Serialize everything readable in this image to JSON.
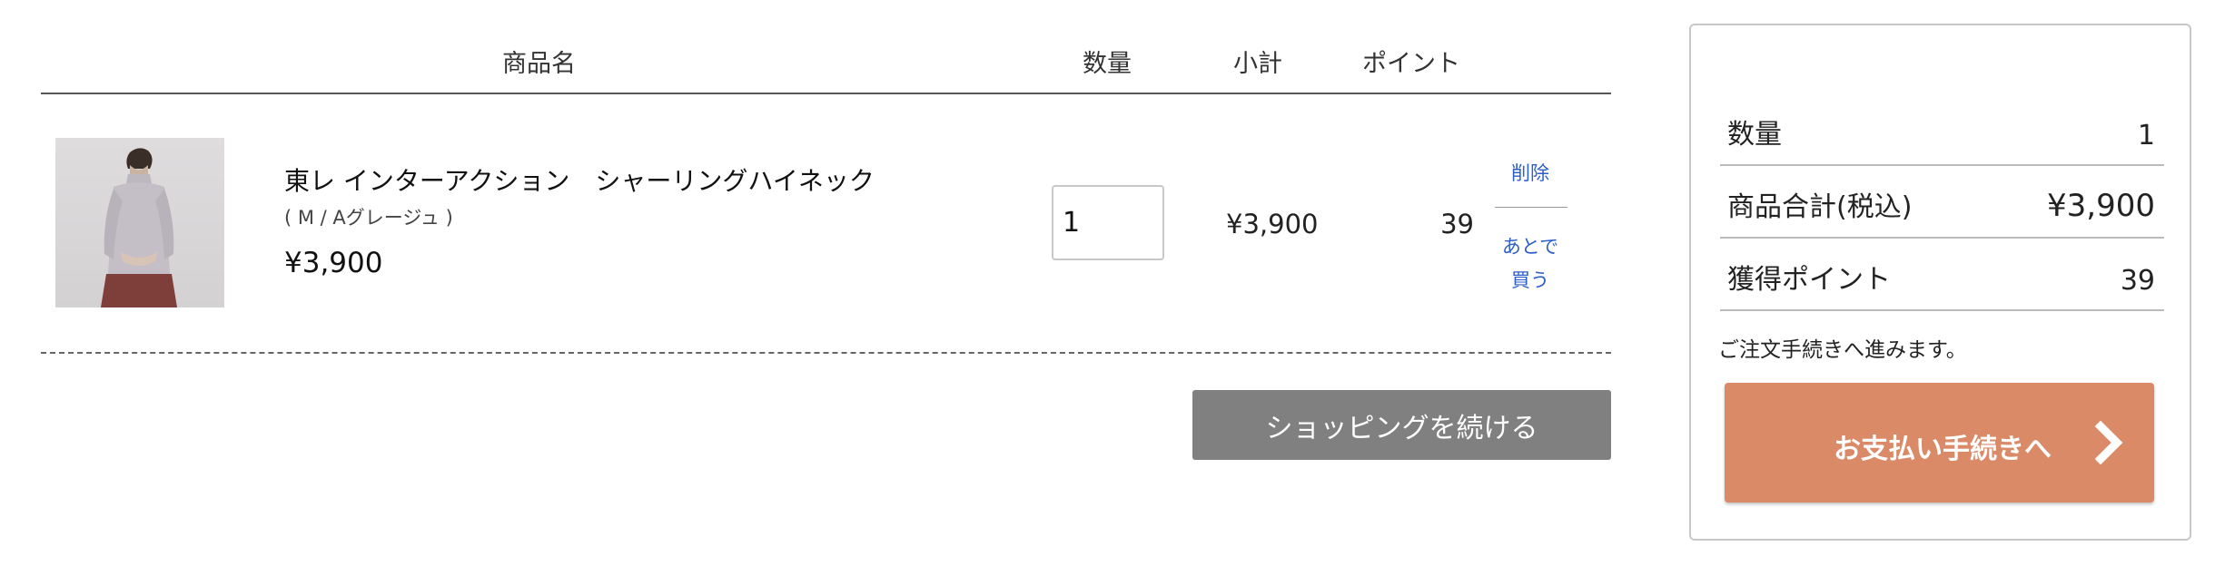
{
  "cart": {
    "headers": {
      "name": "商品名",
      "quantity": "数量",
      "subtotal": "小計",
      "points": "ポイント"
    },
    "item": {
      "name": "東レ インターアクション　シャーリングハイネック",
      "variant": "( M / Aグレージュ )",
      "price": "¥3,900",
      "quantity": "1",
      "subtotal": "¥3,900",
      "points": "39",
      "delete_label": "削除",
      "later_label_1": "あとで",
      "later_label_2": "買う"
    },
    "continue_label": "ショッピングを続ける"
  },
  "summary": {
    "quantity_label": "数量",
    "quantity_value": "1",
    "total_label": "商品合計(税込)",
    "total_value": "¥3,900",
    "points_label": "獲得ポイント",
    "points_value": "39",
    "notice": "ご注文手続きへ進みます。",
    "checkout_label": "お支払い手続きへ"
  },
  "colors": {
    "checkout_button": "#db8a68",
    "continue_button": "#808080",
    "link": "#2c5fc7"
  },
  "icons": {
    "checkout_arrow": "chevron-right-icon"
  }
}
